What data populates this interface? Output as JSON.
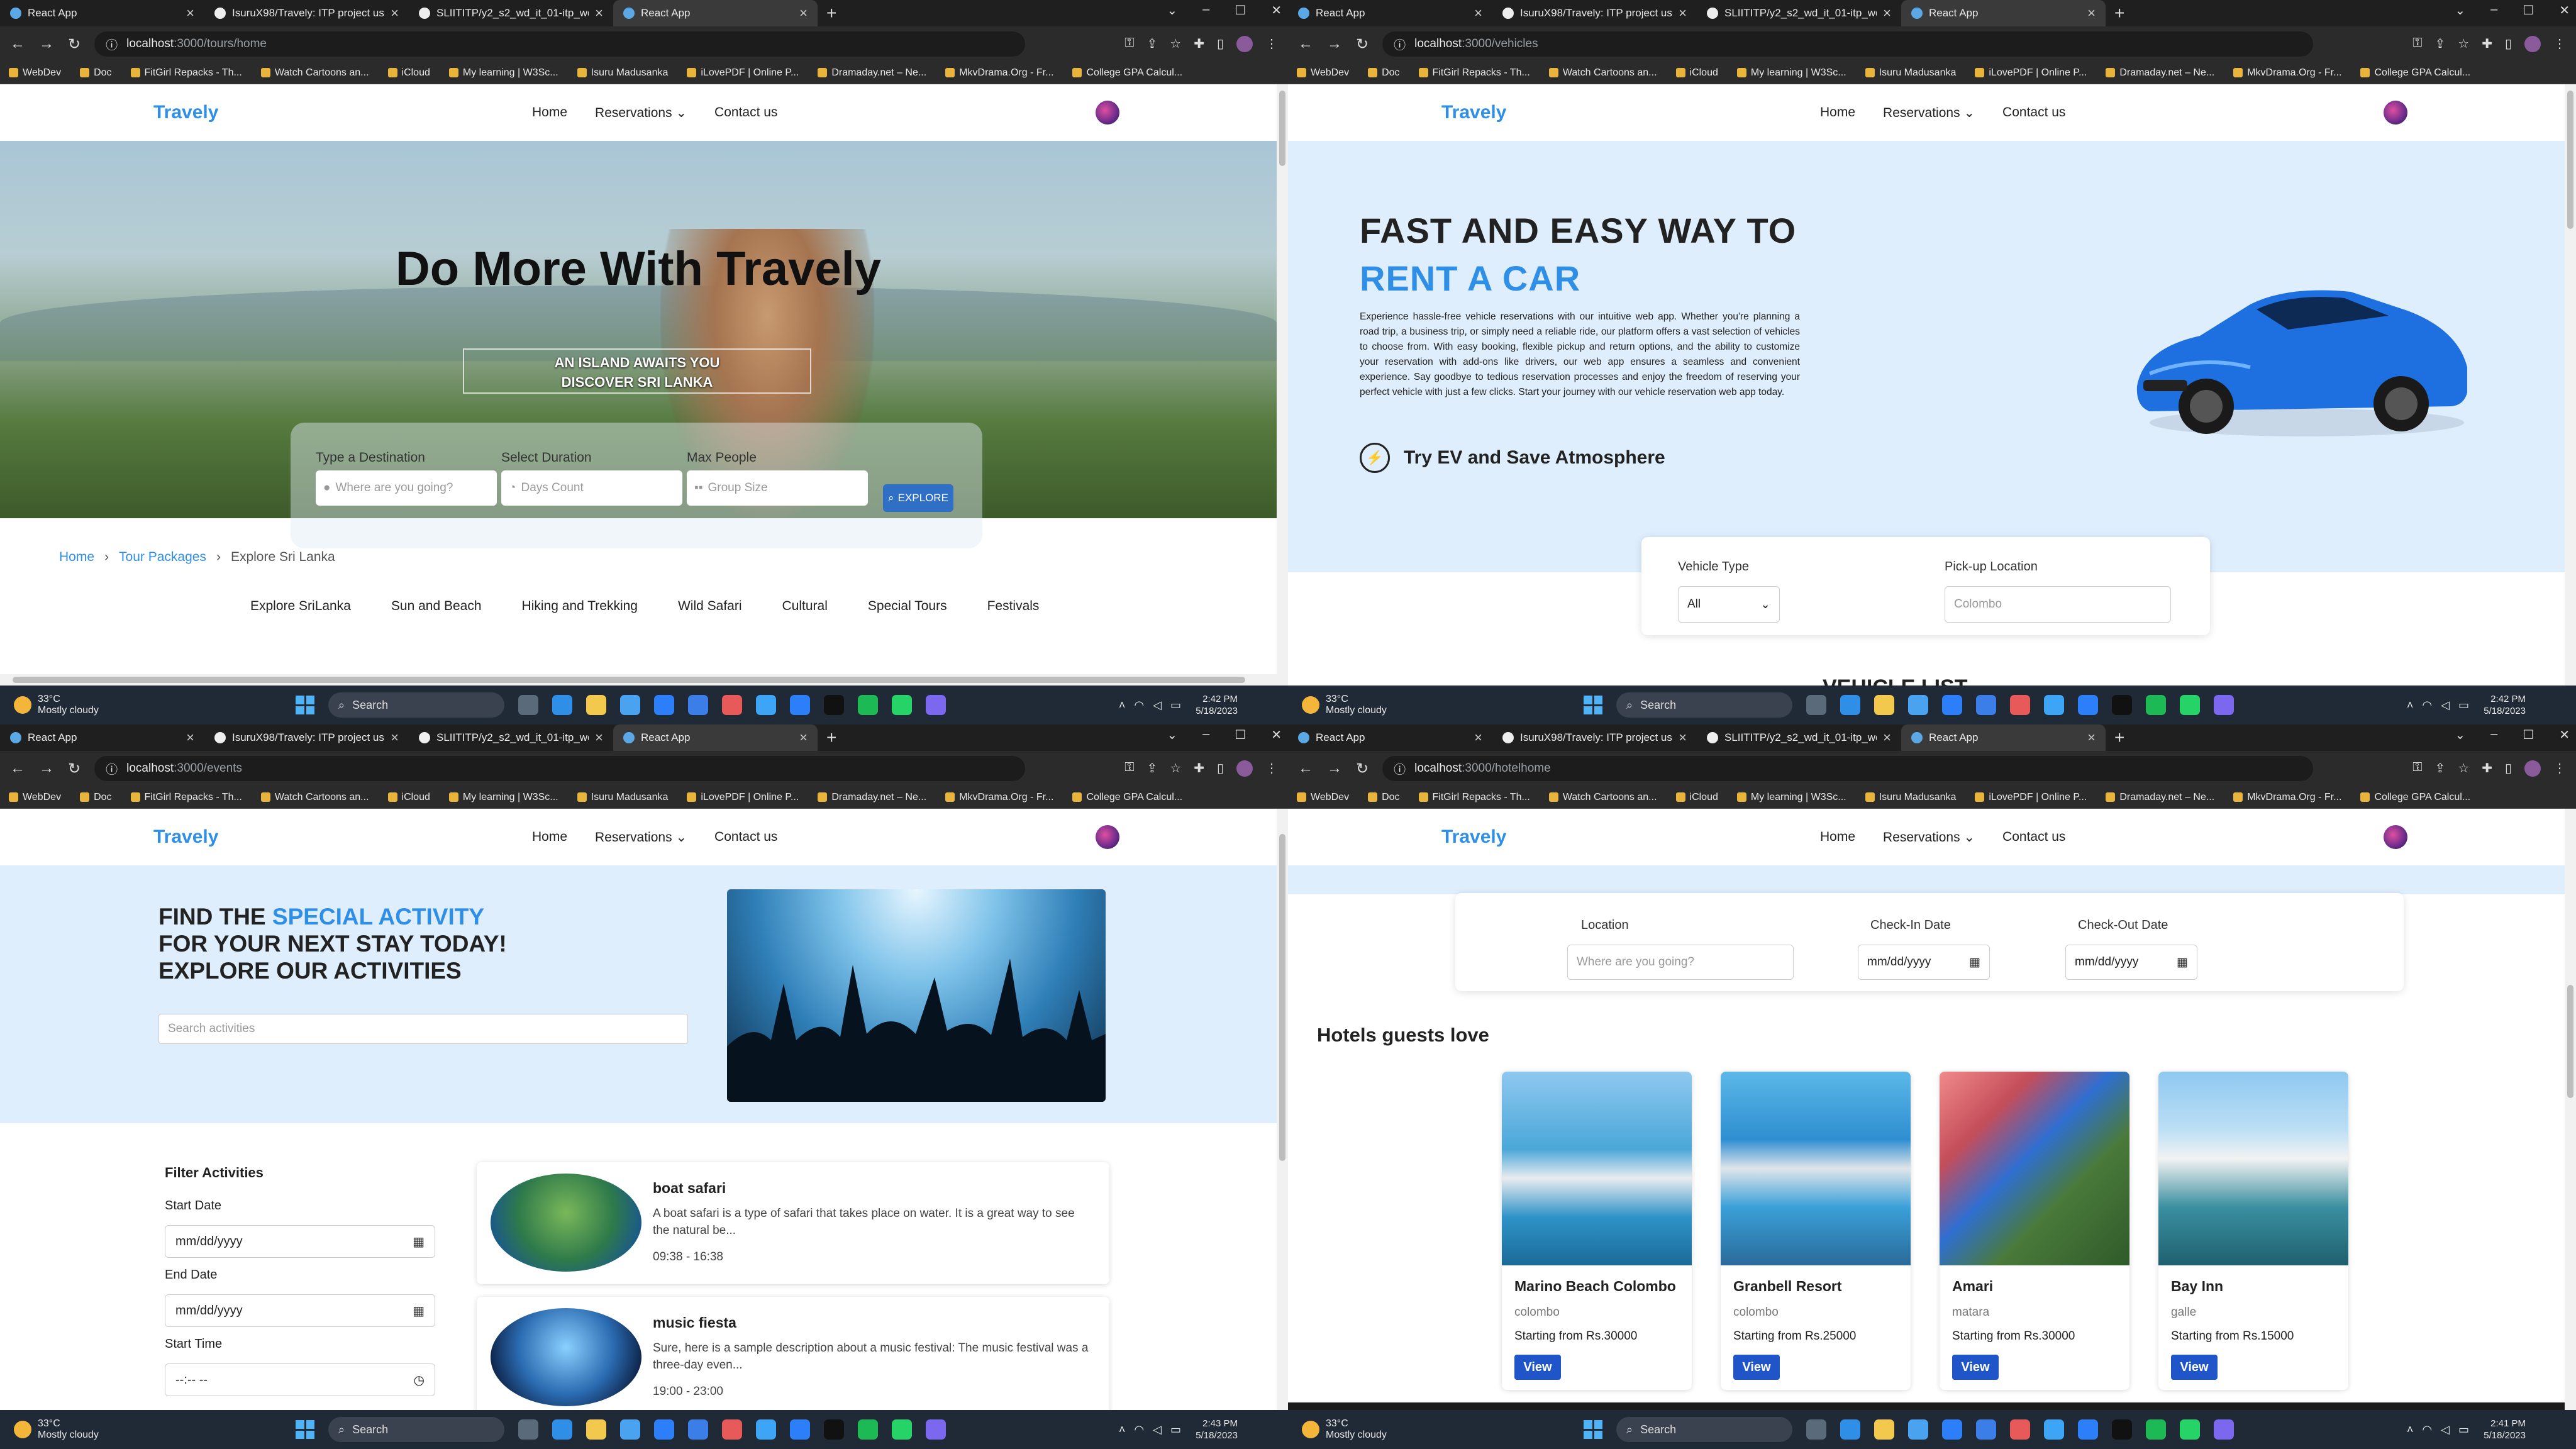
{
  "browser": {
    "tabs": [
      "React App",
      "IsuruX98/Travely: ITP project usin",
      "SLIITITP/y2_s2_wd_it_01-itp_wd_",
      "React App"
    ],
    "new_tab": "+",
    "bookmarks": [
      "WebDev",
      "Doc",
      "FitGirl Repacks - Th...",
      "Watch Cartoons an...",
      "iCloud",
      "My learning | W3Sc...",
      "Isuru Madusanka",
      "iLovePDF | Online P...",
      "Dramaday.net – Ne...",
      "MkvDrama.Org - Fr...",
      "College GPA Calcul..."
    ],
    "host": "localhost",
    "icons": [
      "back-icon",
      "forward-icon",
      "reload-icon",
      "key-icon",
      "extension-icon",
      "zoom-icon",
      "share-icon",
      "star-icon",
      "puzzle-icon",
      "sidebar-icon",
      "profile-icon",
      "menu-icon"
    ]
  },
  "site": {
    "logo": "Travely",
    "nav": [
      "Home",
      "Reservations",
      "Contact us"
    ]
  },
  "taskbar": {
    "temp": "33°C",
    "condition": "Mostly cloudy",
    "search": "Search",
    "date": "5/18/2023"
  },
  "q1": {
    "path": ":3000/tours/home",
    "hero_title": "Do More With Travely",
    "tagline_1": "AN ISLAND AWAITS YOU",
    "tagline_2": "DISCOVER SRI LANKA",
    "fields": [
      {
        "label": "Type a Destination",
        "placeholder": "Where are you going?"
      },
      {
        "label": "Select Duration",
        "placeholder": "Days Count"
      },
      {
        "label": "Max People",
        "placeholder": "Group Size"
      }
    ],
    "explore": "EXPLORE",
    "crumbs": [
      "Home",
      "Tour Packages",
      "Explore Sri Lanka"
    ],
    "categories": [
      "Explore SriLanka",
      "Sun and Beach",
      "Hiking and Trekking",
      "Wild Safari",
      "Cultural",
      "Special Tours",
      "Festivals"
    ],
    "time": "2:42 PM"
  },
  "q2": {
    "path": ":3000/vehicles",
    "title_1": "FAST AND EASY WAY TO",
    "title_2": "RENT A CAR",
    "para": "Experience hassle-free vehicle reservations with our intuitive web app. Whether you're planning a road trip, a business trip, or simply need a reliable ride, our platform offers a vast selection of vehicles to choose from. With easy booking, flexible pickup and return options, and the ability to customize your reservation with add-ons like drivers, our web app ensures a seamless and convenient experience. Say goodbye to tedious reservation processes and enjoy the freedom of reserving your perfect vehicle with just a few clicks. Start your journey with our vehicle reservation web app today.",
    "ev": "Try EV and Save Atmosphere",
    "vehicle_type_label": "Vehicle Type",
    "vehicle_type_value": "All",
    "pickup_label": "Pick-up Location",
    "pickup_placeholder": "Colombo",
    "list_head": "VEHICLE LIST",
    "time": "2:42 PM"
  },
  "q3": {
    "path": ":3000/events",
    "h_find": "FIND THE ",
    "h_special": "SPECIAL ACTIVITY",
    "h_line2": "FOR YOUR NEXT STAY TODAY!",
    "h_line3": "EXPLORE OUR ACTIVITIES",
    "search_placeholder": "Search activities",
    "filter_title": "Filter Activities",
    "start_date": "Start Date",
    "end_date": "End Date",
    "start_time": "Start Time",
    "date_placeholder": "mm/dd/yyyy",
    "time_placeholder": "--:-- --",
    "activities": [
      {
        "title": "boat safari",
        "desc": "A boat safari is a type of safari that takes place on water. It is a great way to see the natural be...",
        "time": "09:38 - 16:38"
      },
      {
        "title": "music fiesta",
        "desc": "Sure, here is a sample description about a music festival: The music festival was a three-day even...",
        "time": "19:00 - 23:00"
      }
    ],
    "time": "2:43 PM"
  },
  "q4": {
    "path": ":3000/hotelhome",
    "location_label": "Location",
    "location_placeholder": "Where are you going?",
    "checkin_label": "Check-In Date",
    "checkout_label": "Check-Out Date",
    "date_placeholder": "mm/dd/yyyy",
    "hotels_head": "Hotels guests love",
    "hotels": [
      {
        "name": "Marino Beach Colombo",
        "location": "colombo",
        "price": "Starting from Rs.30000",
        "view": "View"
      },
      {
        "name": "Granbell Resort",
        "location": "colombo",
        "price": "Starting from Rs.25000",
        "view": "View"
      },
      {
        "name": "Amari",
        "location": "matara",
        "price": "Starting from Rs.30000",
        "view": "View"
      },
      {
        "name": "Bay Inn",
        "location": "galle",
        "price": "Starting from Rs.15000",
        "view": "View"
      }
    ],
    "time": "2:41 PM"
  }
}
